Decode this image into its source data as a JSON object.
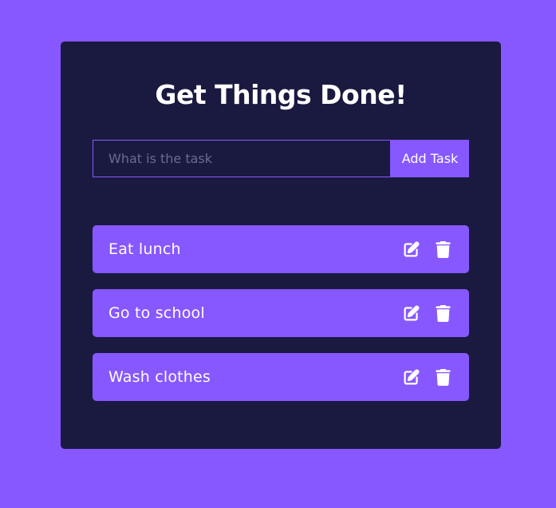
{
  "header": {
    "title": "Get Things Done!"
  },
  "form": {
    "placeholder": "What is the task",
    "value": "",
    "add_label": "Add Task"
  },
  "todos": [
    {
      "text": "Eat lunch",
      "edit_icon": "edit-icon",
      "delete_icon": "trash-icon"
    },
    {
      "text": "Go to school",
      "edit_icon": "edit-icon",
      "delete_icon": "trash-icon"
    },
    {
      "text": "Wash clothes",
      "edit_icon": "edit-icon",
      "delete_icon": "trash-icon"
    }
  ],
  "colors": {
    "background": "#8758ff",
    "card": "#1a1a40",
    "accent": "#8758ff",
    "text": "#ffffff",
    "placeholder": "#6b6b8f"
  }
}
